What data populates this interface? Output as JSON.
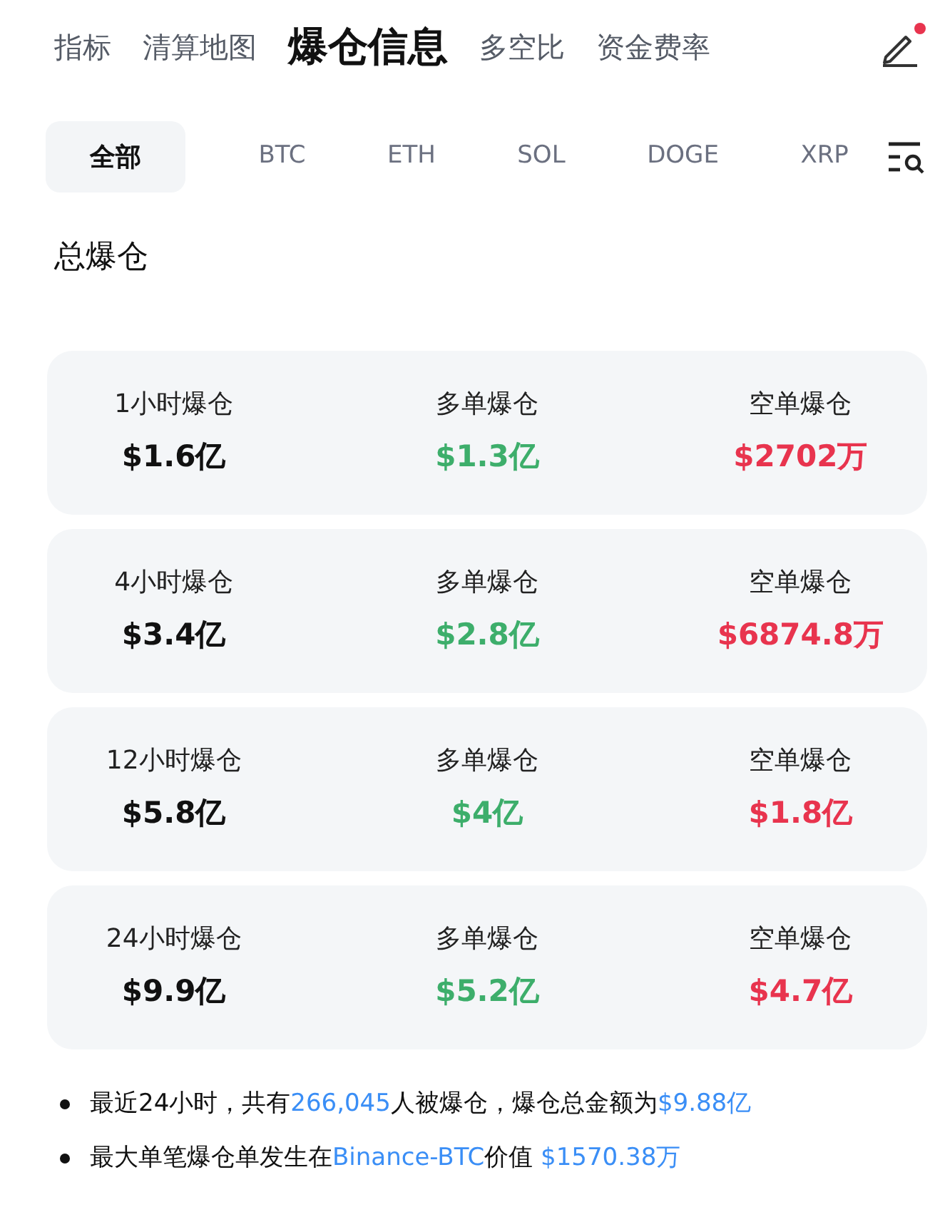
{
  "nav_tabs": [
    {
      "label": "指标",
      "selected": false
    },
    {
      "label": "清算地图",
      "selected": false
    },
    {
      "label": "爆仓信息",
      "selected": true
    },
    {
      "label": "多空比",
      "selected": false
    },
    {
      "label": "资金费率",
      "selected": false
    }
  ],
  "edit_badge": true,
  "coin_filters": [
    {
      "label": "全部",
      "selected": true
    },
    {
      "label": "BTC",
      "selected": false
    },
    {
      "label": "ETH",
      "selected": false
    },
    {
      "label": "SOL",
      "selected": false
    },
    {
      "label": "DOGE",
      "selected": false
    },
    {
      "label": "XRP",
      "selected": false
    }
  ],
  "section_title": "总爆仓",
  "cards": [
    {
      "cells": [
        {
          "kind": "total",
          "label": "1小时爆仓",
          "value": "$1.6亿"
        },
        {
          "kind": "long",
          "label": "多单爆仓",
          "value": "$1.3亿"
        },
        {
          "kind": "short",
          "label": "空单爆仓",
          "value": "$2702万"
        }
      ]
    },
    {
      "cells": [
        {
          "kind": "total",
          "label": "4小时爆仓",
          "value": "$3.4亿"
        },
        {
          "kind": "long",
          "label": "多单爆仓",
          "value": "$2.8亿"
        },
        {
          "kind": "short",
          "label": "空单爆仓",
          "value": "$6874.8万"
        }
      ]
    },
    {
      "cells": [
        {
          "kind": "total",
          "label": "12小时爆仓",
          "value": "$5.8亿"
        },
        {
          "kind": "long",
          "label": "多单爆仓",
          "value": "$4亿"
        },
        {
          "kind": "short",
          "label": "空单爆仓",
          "value": "$1.8亿"
        }
      ]
    },
    {
      "cells": [
        {
          "kind": "total",
          "label": "24小时爆仓",
          "value": "$9.9亿"
        },
        {
          "kind": "long",
          "label": "多单爆仓",
          "value": "$5.2亿"
        },
        {
          "kind": "short",
          "label": "空单爆仓",
          "value": "$4.7亿"
        }
      ]
    }
  ],
  "notes": [
    {
      "segments": [
        {
          "text": "最近24小时，共有",
          "highlight": false
        },
        {
          "text": "266,045",
          "highlight": true
        },
        {
          "text": "人被爆仓，爆仓总金额为",
          "highlight": false
        },
        {
          "text": "$9.88亿",
          "highlight": true
        }
      ]
    },
    {
      "segments": [
        {
          "text": "最大单笔爆仓单发生在",
          "highlight": false
        },
        {
          "text": "Binance-BTC",
          "highlight": true
        },
        {
          "text": "价值 ",
          "highlight": false
        },
        {
          "text": "$1570.38万",
          "highlight": true
        }
      ]
    }
  ]
}
